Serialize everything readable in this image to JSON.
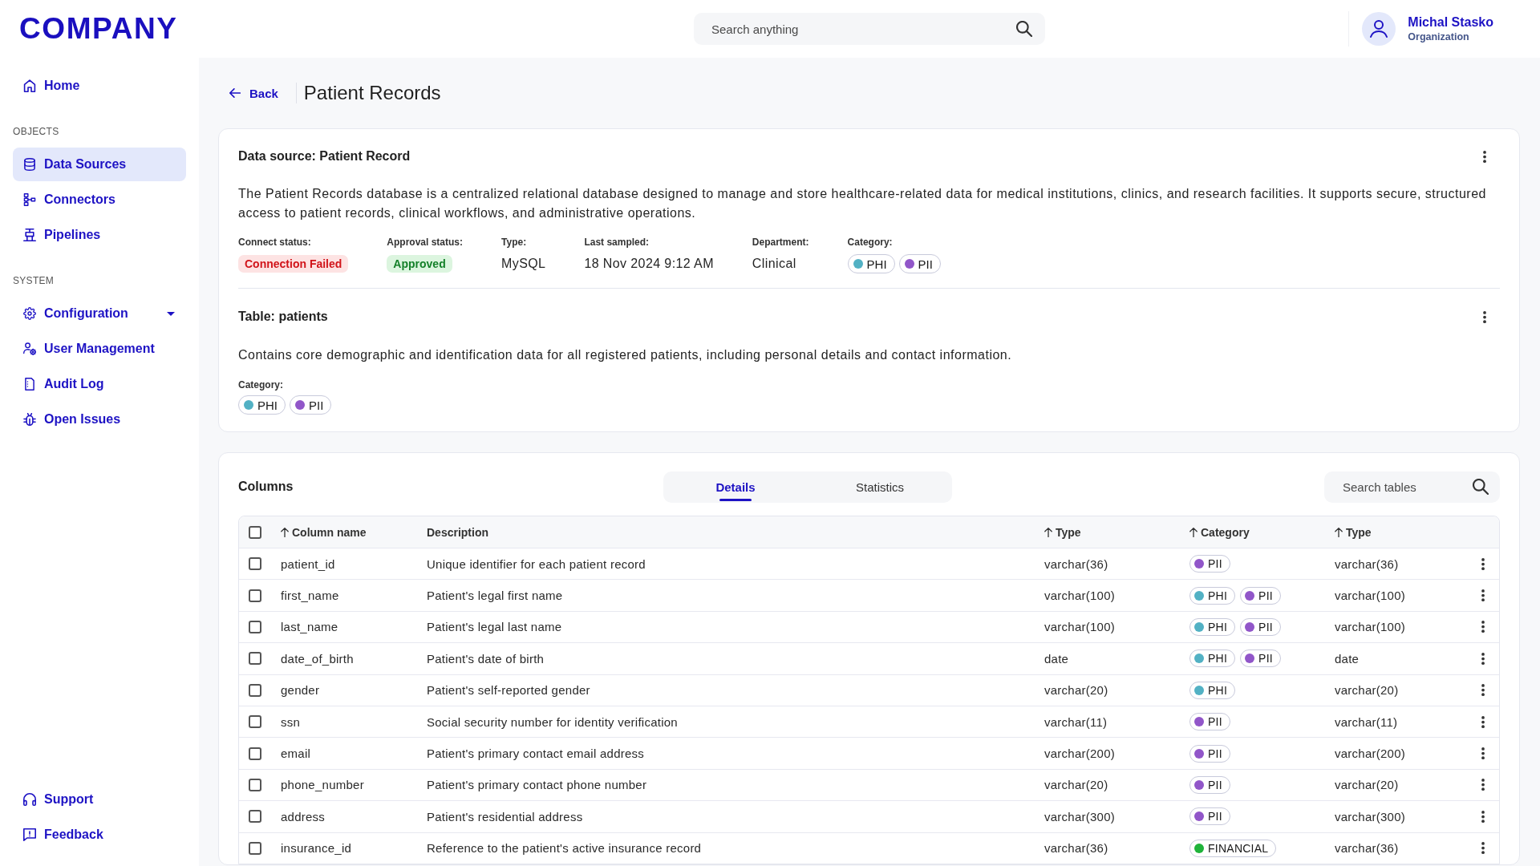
{
  "header": {
    "logo": "COMPANY",
    "search": {
      "placeholder": "Search anything"
    },
    "user": {
      "name": "Michal Stasko",
      "organization": "Organization"
    }
  },
  "sidebar": {
    "sections": [
      {
        "items": [
          {
            "label": "Home",
            "selected": false
          }
        ]
      },
      {
        "title": "OBJECTS",
        "items": [
          {
            "label": "Data Sources",
            "selected": true
          },
          {
            "label": "Connectors",
            "selected": false
          },
          {
            "label": "Pipelines",
            "selected": false
          }
        ]
      },
      {
        "title": "SYSTEM",
        "items": [
          {
            "label": "Configuration",
            "selected": false,
            "expanded": false
          },
          {
            "label": "User Management",
            "selected": false
          },
          {
            "label": "Audit Log",
            "selected": false
          },
          {
            "label": "Open Issues",
            "selected": false
          }
        ]
      }
    ],
    "footer_items": [
      {
        "label": "Support",
        "selected": false
      },
      {
        "label": "Feedback",
        "selected": false
      }
    ]
  },
  "page": {
    "back_label": "Back",
    "title": "Patient Records"
  },
  "data_source": {
    "title": "Data source: Patient Record",
    "description": "The Patient Records database is a centralized relational database designed to manage and store healthcare-related data for medical institutions, clinics, and research facilities. It supports secure, structured access to patient records, clinical workflows, and administrative operations.",
    "fields": [
      {
        "label": "Connect status:",
        "kind": "danger",
        "value": "Connection Failed"
      },
      {
        "label": "Approval status:",
        "kind": "success",
        "value": "Approved"
      },
      {
        "label": "Type:",
        "kind": "text",
        "value": "MySQL"
      },
      {
        "label": "Last sampled:",
        "kind": "text",
        "value": "18 Nov 2024 9:12 AM"
      },
      {
        "label": "Department:",
        "kind": "text",
        "value": "Clinical"
      },
      {
        "label": "Category:",
        "kind": "tags",
        "tags": [
          {
            "label": "PHI",
            "color": "#52b1c4"
          },
          {
            "label": "PII",
            "color": "#9156c9"
          }
        ]
      }
    ]
  },
  "table_info": {
    "title": "Table: patients",
    "description": "Contains core demographic and identification data for all registered patients, including personal details and contact information.",
    "category_label": "Category:",
    "tags": [
      {
        "label": "PHI",
        "color": "#52b1c4"
      },
      {
        "label": "PII",
        "color": "#9156c9"
      }
    ]
  },
  "columns_panel": {
    "title": "Columns",
    "tabs": [
      {
        "label": "Details",
        "selected": true
      },
      {
        "label": "Statistics",
        "selected": false
      }
    ],
    "search": {
      "placeholder": "Search tables"
    },
    "table": {
      "all_checked": false,
      "columns": [
        {
          "label": "Column name",
          "sorted": true
        },
        {
          "label": "Description",
          "sorted": false
        },
        {
          "label": "Type",
          "sorted": true
        },
        {
          "label": "Category",
          "sorted": true
        },
        {
          "label": "Type",
          "sorted": true
        }
      ],
      "rows": [
        {
          "checked": false,
          "column_name": "patient_id",
          "description": "Unique identifier for each patient record",
          "type": "varchar(36)",
          "category": [
            {
              "label": "PII",
              "color": "#9156c9"
            }
          ],
          "type_2": "varchar(36)"
        },
        {
          "checked": false,
          "column_name": "first_name",
          "description": "Patient's legal first name",
          "type": "varchar(100)",
          "category": [
            {
              "label": "PHI",
              "color": "#52b1c4"
            },
            {
              "label": "PII",
              "color": "#9156c9"
            }
          ],
          "type_2": "varchar(100)"
        },
        {
          "checked": false,
          "column_name": "last_name",
          "description": "Patient's legal last name",
          "type": "varchar(100)",
          "category": [
            {
              "label": "PHI",
              "color": "#52b1c4"
            },
            {
              "label": "PII",
              "color": "#9156c9"
            }
          ],
          "type_2": "varchar(100)"
        },
        {
          "checked": false,
          "column_name": "date_of_birth",
          "description": "Patient's date of birth",
          "type": "date",
          "category": [
            {
              "label": "PHI",
              "color": "#52b1c4"
            },
            {
              "label": "PII",
              "color": "#9156c9"
            }
          ],
          "type_2": "date"
        },
        {
          "checked": false,
          "column_name": "gender",
          "description": "Patient's self-reported gender",
          "type": "varchar(20)",
          "category": [
            {
              "label": "PHI",
              "color": "#52b1c4"
            }
          ],
          "type_2": "varchar(20)"
        },
        {
          "checked": false,
          "column_name": "ssn",
          "description": "Social security number for identity verification",
          "type": "varchar(11)",
          "category": [
            {
              "label": "PII",
              "color": "#9156c9"
            }
          ],
          "type_2": "varchar(11)"
        },
        {
          "checked": false,
          "column_name": "email",
          "description": "Patient's primary contact email address",
          "type": "varchar(200)",
          "category": [
            {
              "label": "PII",
              "color": "#9156c9"
            }
          ],
          "type_2": "varchar(200)"
        },
        {
          "checked": false,
          "column_name": "phone_number",
          "description": "Patient's primary contact phone number",
          "type": "varchar(20)",
          "category": [
            {
              "label": "PII",
              "color": "#9156c9"
            }
          ],
          "type_2": "varchar(20)"
        },
        {
          "checked": false,
          "column_name": "address",
          "description": "Patient's residential address",
          "type": "varchar(300)",
          "category": [
            {
              "label": "PII",
              "color": "#9156c9"
            }
          ],
          "type_2": "varchar(300)"
        },
        {
          "checked": false,
          "column_name": "insurance_id",
          "description": "Reference to the patient's active insurance record",
          "type": "varchar(36)",
          "category": [
            {
              "label": "FINANCIAL",
              "color": "#1fb33a"
            }
          ],
          "type_2": "varchar(36)"
        }
      ]
    }
  }
}
